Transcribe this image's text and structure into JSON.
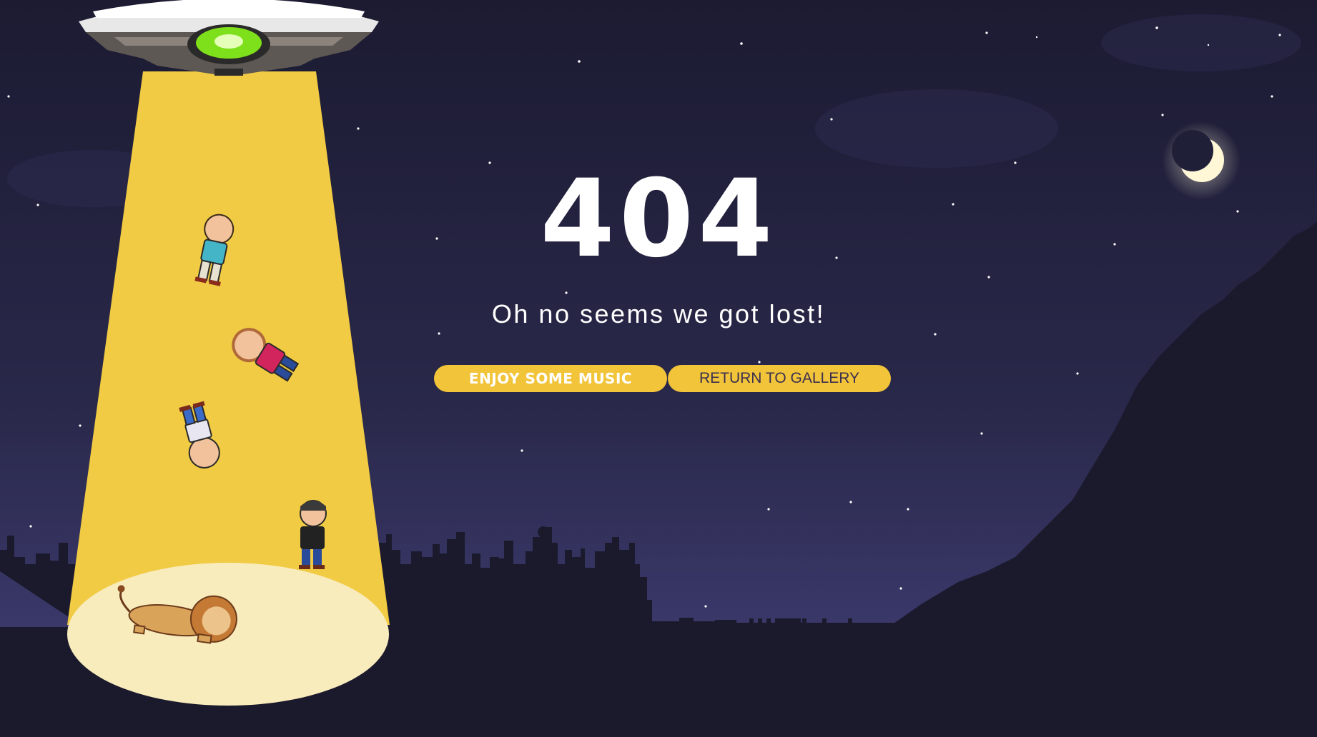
{
  "error": {
    "code": "404",
    "message": "Oh no seems we got lost!"
  },
  "actions": {
    "music_label": "ENJOY SOME MUSIC",
    "gallery_label": "RETURN TO GALLERY"
  },
  "icons": [
    "ufo-icon",
    "moon-icon",
    "lion-icon"
  ],
  "colors": {
    "sky": "#2a2848",
    "silhouette": "#1b1a2d",
    "beam": "#f1cb43",
    "beam_pool": "#f8ebbc",
    "button": "#f2c43a",
    "ufo_light": "#7ee01a",
    "moon": "#fff7d6"
  }
}
